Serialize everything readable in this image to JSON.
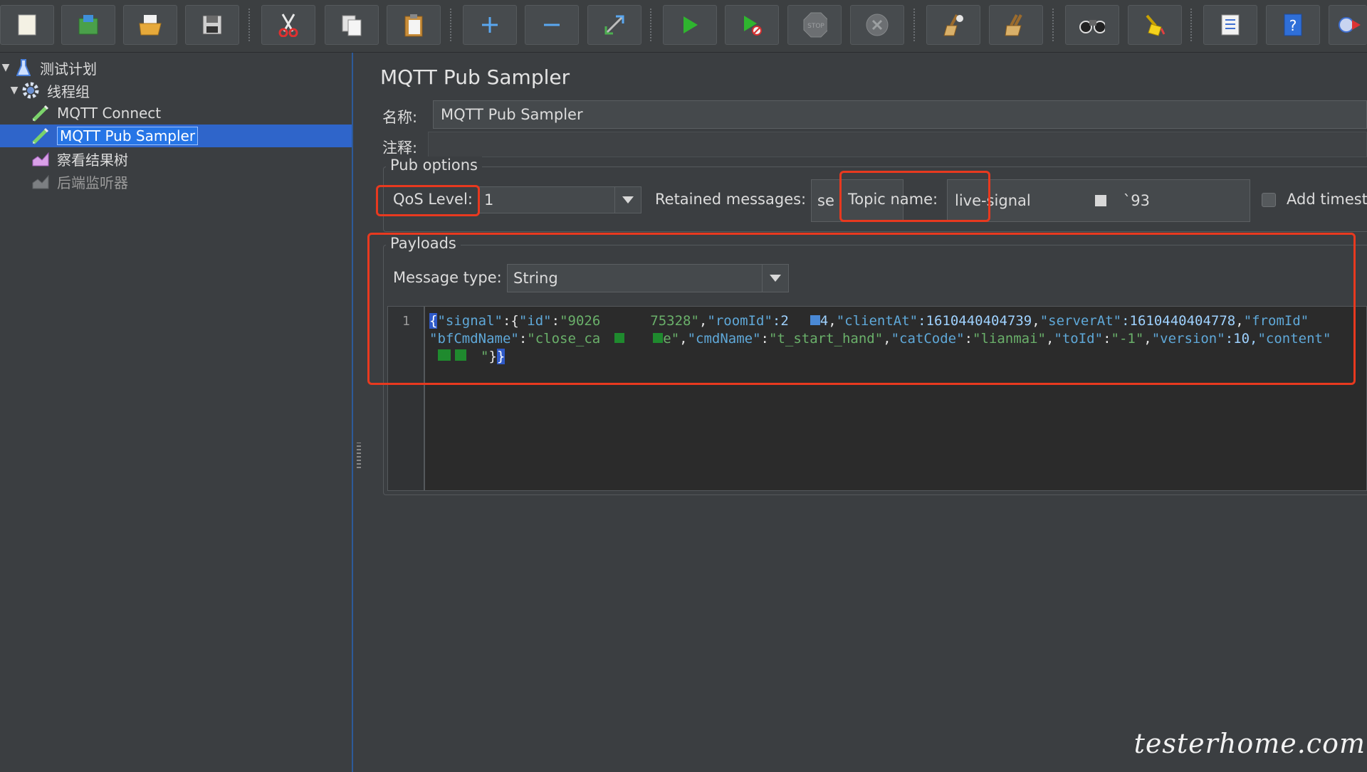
{
  "toolbar": {
    "buttons": [
      {
        "name": "new-button",
        "icon": "new-file-icon"
      },
      {
        "name": "templates-button",
        "icon": "templates-icon"
      },
      {
        "name": "open-button",
        "icon": "open-folder-icon"
      },
      {
        "name": "save-button",
        "icon": "save-icon"
      },
      {
        "name": "cut-button",
        "icon": "scissors-icon"
      },
      {
        "name": "copy-button",
        "icon": "copy-icon"
      },
      {
        "name": "paste-button",
        "icon": "paste-icon"
      },
      {
        "name": "expand-button",
        "icon": "plus-icon"
      },
      {
        "name": "collapse-button",
        "icon": "minus-icon"
      },
      {
        "name": "toggle-button",
        "icon": "toggle-icon"
      },
      {
        "name": "start-button",
        "icon": "play-icon"
      },
      {
        "name": "start-no-timers-button",
        "icon": "play-no-timer-icon"
      },
      {
        "name": "stop-button",
        "icon": "stop-icon"
      },
      {
        "name": "shutdown-button",
        "icon": "shutdown-icon"
      },
      {
        "name": "clear-button",
        "icon": "broom-icon"
      },
      {
        "name": "clear-all-button",
        "icon": "broom-all-icon"
      },
      {
        "name": "search-button",
        "icon": "binoculars-icon"
      },
      {
        "name": "reset-search-button",
        "icon": "broom-yellow-icon"
      },
      {
        "name": "function-helper-button",
        "icon": "list-icon"
      },
      {
        "name": "help-button",
        "icon": "help-icon",
        "text": "?"
      }
    ],
    "stop_text": "STOP"
  },
  "tree": {
    "items": [
      {
        "label": "测试计划",
        "icon": "test-plan-flask-icon",
        "level": 0,
        "expanded": true
      },
      {
        "label": "线程组",
        "icon": "thread-group-gear-icon",
        "level": 1,
        "expanded": true
      },
      {
        "label": "MQTT Connect",
        "icon": "sampler-pen-icon",
        "level": 2
      },
      {
        "label": "MQTT Pub Sampler",
        "icon": "sampler-pen-icon",
        "level": 2,
        "selected": true
      },
      {
        "label": "察看结果树",
        "icon": "listener-chart-icon",
        "level": 2
      },
      {
        "label": "后端监听器",
        "icon": "listener-chart-icon",
        "level": 2,
        "disabled": true
      }
    ]
  },
  "panel": {
    "title": "MQTT Pub Sampler",
    "name_label": "名称:",
    "name_value": "MQTT Pub Sampler",
    "comment_label": "注释:",
    "comment_value": "",
    "pub_options": {
      "title": "Pub options",
      "qos_label": "QoS Level:",
      "qos_value": "1",
      "retained_label": "Retained messages:",
      "retained_value": "se",
      "topic_label": "Topic name:",
      "topic_value_start": "live-",
      "topic_value_mid": "signal",
      "topic_value_end": "`93",
      "add_timestamp_label": "Add timest",
      "add_timestamp_checked": false
    },
    "payloads": {
      "title": "Payloads",
      "message_type_label": "Message type:",
      "message_type_value": "String",
      "line_number": "1",
      "line1": {
        "b1": "{",
        "p1": "\"signal\"",
        "p2": ":{",
        "p3": "\"id\"",
        "p4": ":",
        "p5": "\"9026",
        "p6": "75328\"",
        "p7": ",",
        "p8": "\"roomId\"",
        "p9": ":2",
        "p10": "4",
        "p11": ",",
        "p12": "\"clientAt\"",
        "p13": ":1610440404739",
        "p14": ",",
        "p15": "\"serverAt\"",
        "p16": ":1610440404778",
        "p17": ",",
        "p18": "\"fromId\""
      },
      "line2": {
        "p1": "\"bfCmdName\"",
        "p2": ":",
        "p3": "\"close_ca",
        "p4": "e\"",
        "p5": ",",
        "p6": "\"cmdName\"",
        "p7": ":",
        "p8": "\"t_start_hand\"",
        "p9": ",",
        "p10": "\"catCode\"",
        "p11": ":",
        "p12": "\"lianmai\"",
        "p13": ",",
        "p14": "\"toId\"",
        "p15": ":",
        "p16": "\"-1\"",
        "p17": ",",
        "p18": "\"version\"",
        "p19": ":10,",
        "p20": "\"content\""
      },
      "line3": {
        "p1": "\"",
        "p2": "}",
        "b2": "}"
      }
    }
  },
  "watermark": "testerhome.com",
  "colors": {
    "highlight_red": "#e8391f",
    "selection_blue": "#2f65ca",
    "background": "#3b3e41"
  }
}
